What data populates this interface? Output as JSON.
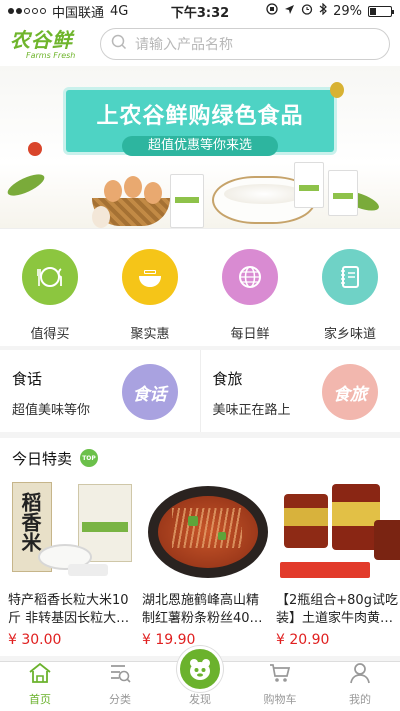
{
  "status_bar": {
    "carrier": "中国联通",
    "network": "4G",
    "time": "下午3:32",
    "battery": "29%",
    "battery_level": 0.29
  },
  "header": {
    "logo_text": "农谷鲜",
    "logo_subtext": "Farms Fresh",
    "search_placeholder": "请输入产品名称"
  },
  "banner": {
    "headline": "上农谷鲜购绿色食品",
    "subline": "超值优惠等你来选"
  },
  "categories": [
    {
      "label": "值得买",
      "icon": "dining-icon",
      "color": "#8cc63f"
    },
    {
      "label": "聚实惠",
      "icon": "bowl-icon",
      "color": "#f5c518"
    },
    {
      "label": "每日鲜",
      "icon": "globe-icon",
      "color": "#d98bd2"
    },
    {
      "label": "家乡味道",
      "icon": "notebook-icon",
      "color": "#6fd2c6"
    }
  ],
  "promos": [
    {
      "title": "食话",
      "subtitle": "超值美味等你",
      "badge": "食话",
      "color": "#a9a2e0"
    },
    {
      "title": "食旅",
      "subtitle": "美味正在路上",
      "badge": "食旅",
      "color": "#f2b7ae"
    }
  ],
  "special": {
    "title": "今日特卖",
    "badge": "TOP",
    "products": [
      {
        "name": "特产稻香长粒大米10斤 非转基因长粒大…",
        "price": "¥ 30.00"
      },
      {
        "name": "湖北恩施鹤峰高山精制红薯粉条粉丝40…",
        "price": "¥ 19.90"
      },
      {
        "name": "【2瓶组合+80g试吃装】土道家牛肉黄…",
        "price": "¥ 20.90"
      }
    ]
  },
  "tabs": [
    {
      "label": "首页",
      "icon": "home-icon"
    },
    {
      "label": "分类",
      "icon": "category-icon"
    },
    {
      "label": "发现",
      "icon": "discover-icon"
    },
    {
      "label": "购物车",
      "icon": "cart-icon"
    },
    {
      "label": "我的",
      "icon": "profile-icon"
    }
  ],
  "colors": {
    "brand_green": "#6bb22d",
    "price_red": "#e02020",
    "banner_teal": "#4ed3c4"
  }
}
